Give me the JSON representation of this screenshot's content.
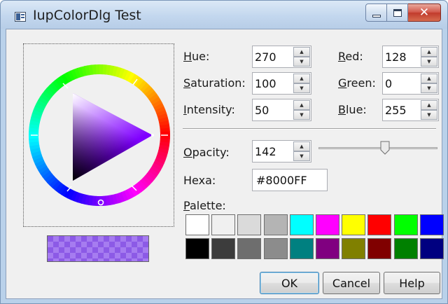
{
  "window": {
    "title": "IupColorDlg Test",
    "close_glyph": "✕"
  },
  "color": {
    "hue": {
      "label_u": "H",
      "label_rest": "ue:",
      "value": "270"
    },
    "saturation": {
      "label_u": "S",
      "label_rest": "aturation:",
      "value": "100"
    },
    "intensity": {
      "label_u": "I",
      "label_rest": "ntensity:",
      "value": "50"
    },
    "red": {
      "label_u": "R",
      "label_rest": "ed:",
      "value": "128"
    },
    "green": {
      "label_u": "G",
      "label_rest": "reen:",
      "value": "0"
    },
    "blue": {
      "label_u": "B",
      "label_rest": "lue:",
      "value": "255"
    },
    "opacity": {
      "label_u": "O",
      "label_rest": "pacity:",
      "value": "142",
      "fraction": 0.557
    },
    "hexa": {
      "label": "Hexa:",
      "value": "#8000FF"
    }
  },
  "palette": {
    "label_u": "P",
    "label_rest": "alette:",
    "swatches": [
      "#ffffff",
      "#f0f0f0",
      "#dadada",
      "#b4b4b4",
      "#00ffff",
      "#ff00ff",
      "#ffff00",
      "#ff0000",
      "#00ff00",
      "#0000ff",
      "#000000",
      "#3c3c3c",
      "#6e6e6e",
      "#8c8c8c",
      "#008080",
      "#800080",
      "#808000",
      "#800000",
      "#008000",
      "#000080"
    ]
  },
  "buttons": {
    "ok": "OK",
    "cancel": "Cancel",
    "help": "Help"
  },
  "accent": "#8000ff",
  "icons": {
    "minimize": "minimize-icon",
    "maximize": "maximize-icon",
    "close": "close-icon",
    "app": "color-dialog-app-icon"
  }
}
